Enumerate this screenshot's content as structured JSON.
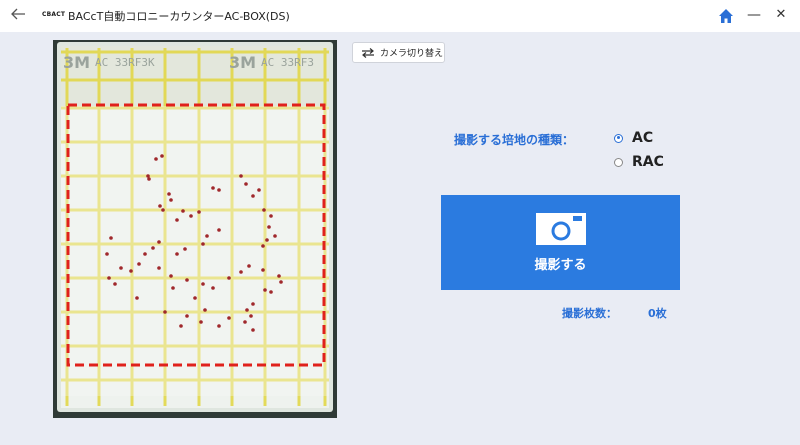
{
  "titlebar": {
    "back_icon": "arrow-left-icon",
    "logo_text": "CBACT",
    "title": "BACcT自動コロニーカウンターAC-BOX(DS)",
    "home_icon": "home-icon",
    "minimize_label": "—",
    "close_label": "✕",
    "accent_color": "#2a6fd6"
  },
  "preview": {
    "plate_brand_left": "3M",
    "plate_code_left": "AC 33RF3K",
    "plate_brand_right": "3M",
    "plate_code_right": "AC 33RF3",
    "frame_color": "#e0211c",
    "grid_color": "#e2d640",
    "colony_color": "#a0282c"
  },
  "controls": {
    "switch_camera_label": "カメラ切り替え",
    "switch_camera_icon": "switch-arrows-icon",
    "medium_label": "撮影する培地の種類：",
    "media_options": [
      {
        "label": "AC",
        "selected": true
      },
      {
        "label": "RAC",
        "selected": false
      }
    ],
    "capture_label": "撮影する",
    "capture_icon": "camera-icon",
    "capture_color": "#2b7be0",
    "count_label": "撮影枚数：",
    "count_value": "0枚"
  }
}
